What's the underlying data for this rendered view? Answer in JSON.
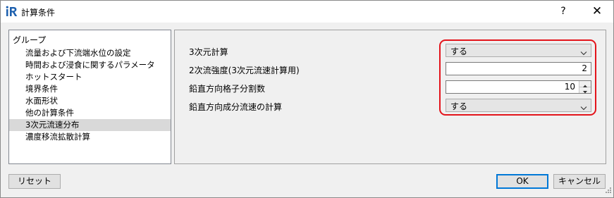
{
  "window": {
    "title": "計算条件",
    "help_label": "?",
    "close_label": "✕"
  },
  "group": {
    "title": "グループ",
    "items": [
      {
        "label": "流量および下流端水位の設定"
      },
      {
        "label": "時間および浸食に関するパラメータ"
      },
      {
        "label": "ホットスタート"
      },
      {
        "label": "境界条件"
      },
      {
        "label": "水面形状"
      },
      {
        "label": "他の計算条件"
      },
      {
        "label": "3次元流速分布",
        "selected": true
      },
      {
        "label": "濃度移流拡散計算"
      }
    ]
  },
  "settings": {
    "calc3d": {
      "label": "3次元計算",
      "value": "する"
    },
    "secondary_flow": {
      "label": "2次流強度(3次元流速計算用)",
      "value": "2"
    },
    "vertical_grid": {
      "label": "鉛直方向格子分割数",
      "value": "10"
    },
    "vertical_velocity": {
      "label": "鉛直方向成分流速の計算",
      "value": "する"
    }
  },
  "buttons": {
    "reset": "リセット",
    "ok": "OK",
    "cancel": "キャンセル"
  },
  "colors": {
    "highlight": "#e3141b",
    "focus_border": "#0078d7",
    "brand_blue": "#1c5fae"
  },
  "icons": {
    "app": "iric-logo-icon",
    "combo_arrow": "chevron-down-icon",
    "spin_up": "spin-up-icon",
    "spin_down": "spin-down-icon",
    "grip": "resize-grip-icon"
  }
}
